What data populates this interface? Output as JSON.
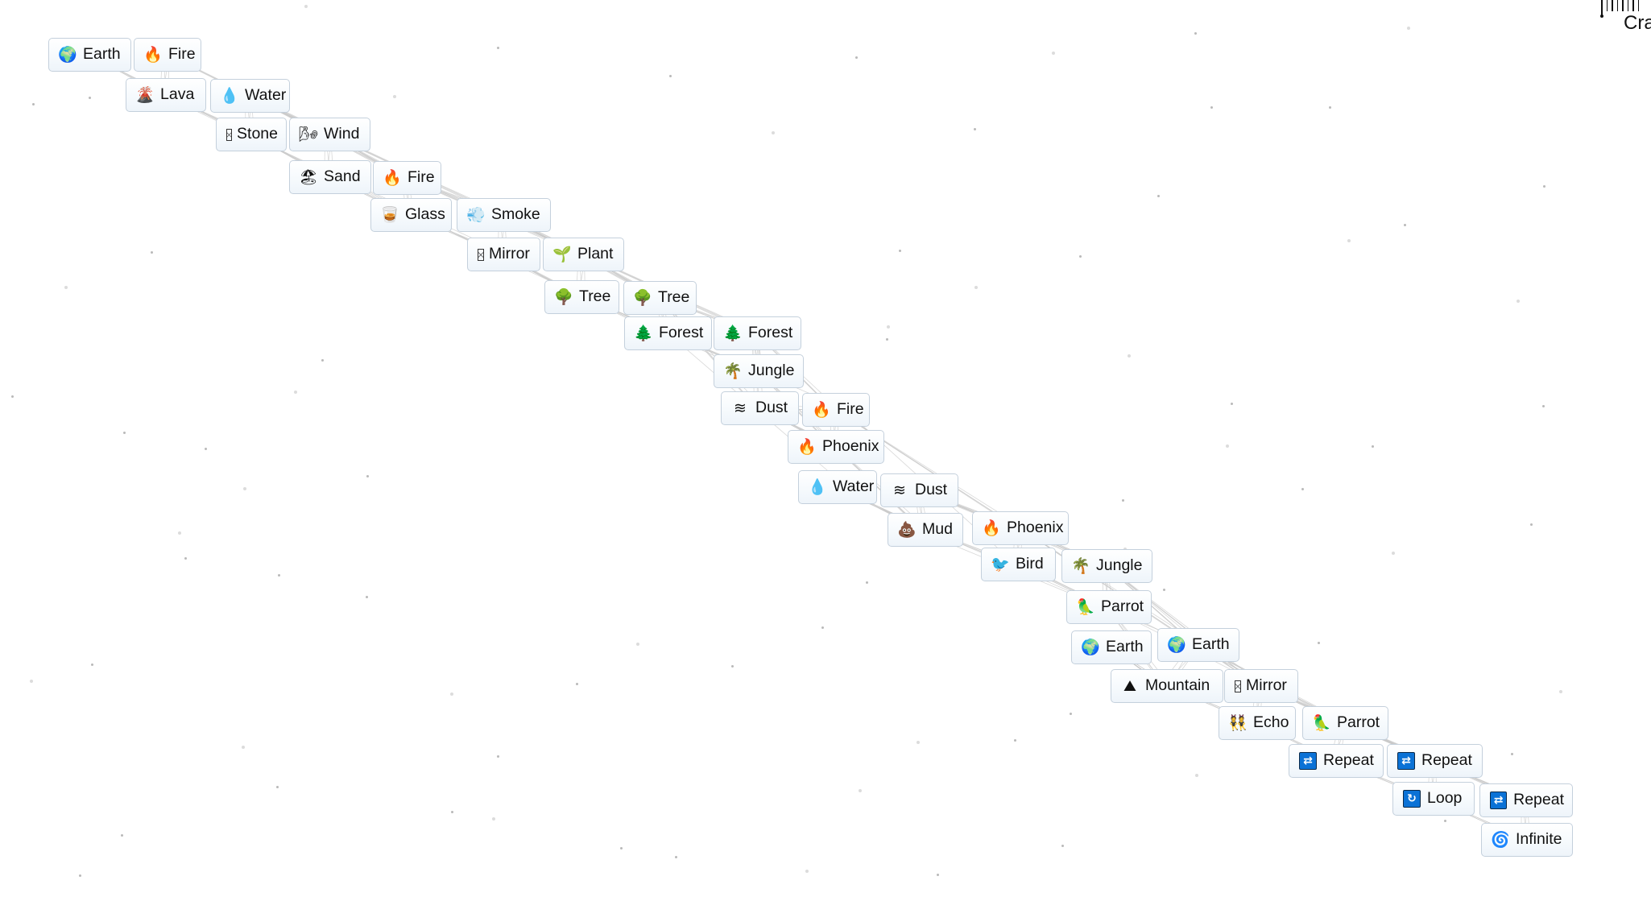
{
  "app": {
    "logo_text_visible": "Cra",
    "logo_full_name": "Infinite Craft"
  },
  "theme": {
    "background": "#ffffff",
    "item_border": "#c4d0dc",
    "item_text": "#111111",
    "link_color": "#c8c8c8",
    "particle_color": "#b9b9b9"
  },
  "items": [
    {
      "label": "Earth",
      "icon": "earth-globe-icon",
      "glyph": "🌍"
    },
    {
      "label": "Fire",
      "icon": "fire-icon",
      "glyph": "🔥"
    },
    {
      "label": "Lava",
      "icon": "volcano-icon",
      "glyph": "🌋"
    },
    {
      "label": "Water",
      "icon": "droplet-icon",
      "glyph": "💧"
    },
    {
      "label": "Stone",
      "icon": "missing-glyph-icon",
      "glyph": ""
    },
    {
      "label": "Wind",
      "icon": "wind-face-icon",
      "glyph": "🌬"
    },
    {
      "label": "Sand",
      "icon": "beach-umbrella-icon",
      "glyph": "🏖"
    },
    {
      "label": "Fire",
      "icon": "fire-icon",
      "glyph": "🔥"
    },
    {
      "label": "Glass",
      "icon": "tumbler-glass-icon",
      "glyph": "🥃"
    },
    {
      "label": "Smoke",
      "icon": "dash-smoke-icon",
      "glyph": "💨"
    },
    {
      "label": "Mirror",
      "icon": "missing-glyph-icon",
      "glyph": ""
    },
    {
      "label": "Plant",
      "icon": "seedling-icon",
      "glyph": "🌱"
    },
    {
      "label": "Tree",
      "icon": "deciduous-tree-icon",
      "glyph": "🌳"
    },
    {
      "label": "Tree",
      "icon": "deciduous-tree-icon",
      "glyph": "🌳"
    },
    {
      "label": "Forest",
      "icon": "evergreen-tree-icon",
      "glyph": "🌲"
    },
    {
      "label": "Forest",
      "icon": "evergreen-tree-icon",
      "glyph": "🌲"
    },
    {
      "label": "Jungle",
      "icon": "palm-tree-icon",
      "glyph": "🌴"
    },
    {
      "label": "Dust",
      "icon": "wavy-lines-icon",
      "glyph": "≋"
    },
    {
      "label": "Fire",
      "icon": "fire-icon",
      "glyph": "🔥"
    },
    {
      "label": "Phoenix",
      "icon": "fire-icon",
      "glyph": "🔥"
    },
    {
      "label": "Water",
      "icon": "droplet-icon",
      "glyph": "💧"
    },
    {
      "label": "Dust",
      "icon": "wavy-lines-icon",
      "glyph": "≋"
    },
    {
      "label": "Mud",
      "icon": "pile-of-poo-icon",
      "glyph": "💩"
    },
    {
      "label": "Phoenix",
      "icon": "fire-icon",
      "glyph": "🔥"
    },
    {
      "label": "Bird",
      "icon": "bird-icon",
      "glyph": "🐦"
    },
    {
      "label": "Jungle",
      "icon": "palm-tree-icon",
      "glyph": "🌴"
    },
    {
      "label": "Parrot",
      "icon": "parrot-icon",
      "glyph": "🦜"
    },
    {
      "label": "Earth",
      "icon": "earth-globe-icon",
      "glyph": "🌍"
    },
    {
      "label": "Earth",
      "icon": "earth-globe-icon",
      "glyph": "🌍"
    },
    {
      "label": "Mountain",
      "icon": "mountain-icon",
      "glyph": "⛰"
    },
    {
      "label": "Mirror",
      "icon": "missing-glyph-icon",
      "glyph": ""
    },
    {
      "label": "Echo",
      "icon": "people-icon",
      "glyph": "👯"
    },
    {
      "label": "Parrot",
      "icon": "parrot-icon",
      "glyph": "🦜"
    },
    {
      "label": "Repeat",
      "icon": "repeat-button-icon",
      "glyph": "⇄"
    },
    {
      "label": "Repeat",
      "icon": "repeat-button-icon",
      "glyph": "⇄"
    },
    {
      "label": "Loop",
      "icon": "loop-arrows-icon",
      "glyph": "↻"
    },
    {
      "label": "Repeat",
      "icon": "repeat-button-icon",
      "glyph": "⇄"
    },
    {
      "label": "Infinite",
      "icon": "cyclone-icon",
      "glyph": "🌀"
    }
  ]
}
